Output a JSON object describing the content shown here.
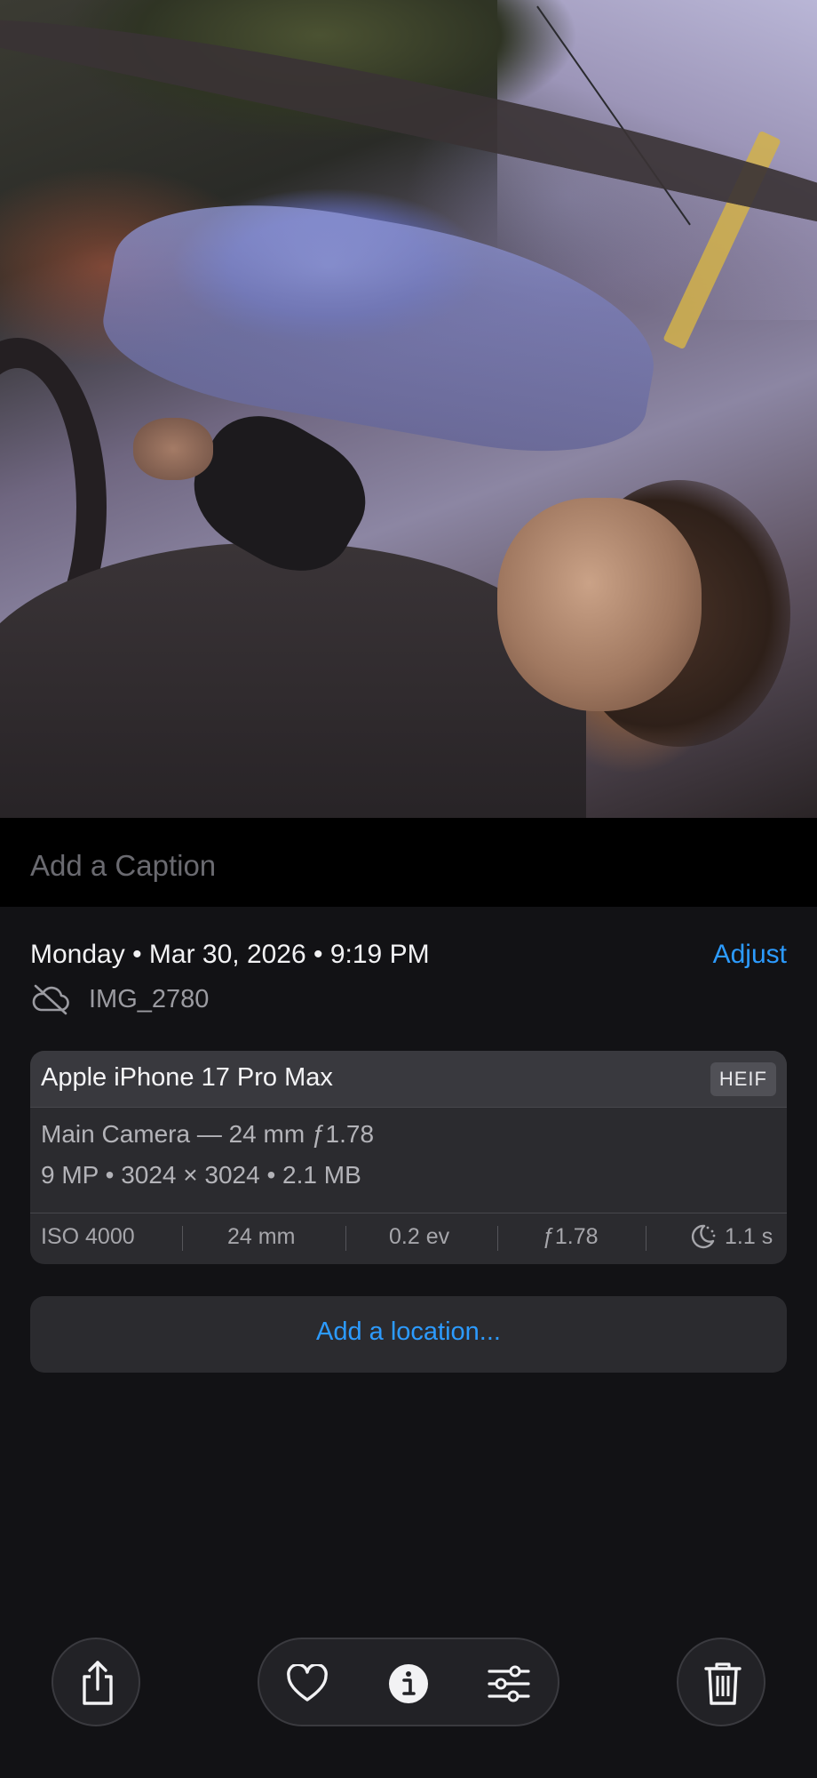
{
  "photo": {
    "description_icon": "photo"
  },
  "caption": {
    "placeholder": "Add a Caption"
  },
  "info": {
    "datetime": "Monday • Mar 30, 2026 • 9:19 PM",
    "adjust_label": "Adjust",
    "cloud_icon": "cloud-slash-icon",
    "filename": "IMG_2780"
  },
  "camera": {
    "device": "Apple iPhone 17 Pro Max",
    "format": "HEIF",
    "lens": "Main Camera — 24 mm ƒ1.78",
    "specs": "9 MP • 3024 × 3024 • 2.1 MB",
    "exif": {
      "iso": "ISO 4000",
      "focal": "24 mm",
      "ev": "0.2 ev",
      "aperture": "ƒ1.78",
      "shutter": "1.1 s",
      "shutter_icon": "night-mode-icon"
    }
  },
  "location": {
    "label": "Add a location..."
  },
  "toolbar": {
    "share_icon": "share-icon",
    "favorite_icon": "heart-icon",
    "info_icon": "info-icon",
    "edit_icon": "sliders-icon",
    "delete_icon": "trash-icon"
  },
  "colors": {
    "accent": "#2c9bff",
    "background": "#121215",
    "card": "#2b2b2f"
  }
}
